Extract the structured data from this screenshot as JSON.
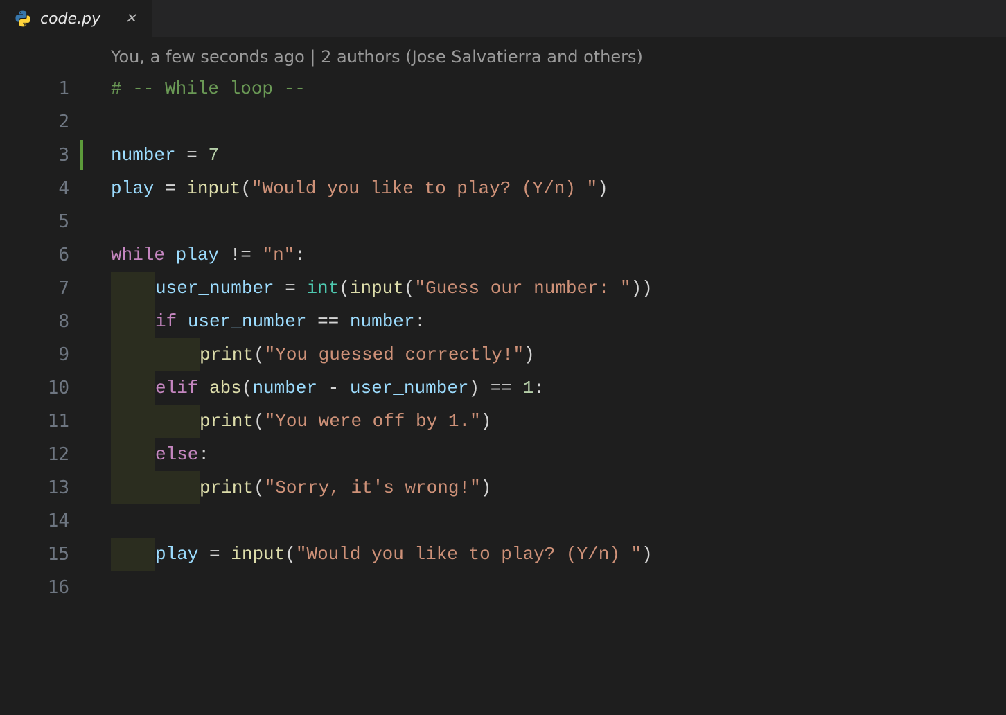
{
  "tab": {
    "filename": "code.py",
    "icon": "python-icon"
  },
  "codelens": "You, a few seconds ago | 2 authors (Jose Salvatierra and others)",
  "line_numbers": [
    "1",
    "2",
    "3",
    "4",
    "5",
    "6",
    "7",
    "8",
    "9",
    "10",
    "11",
    "12",
    "13",
    "14",
    "15",
    "16"
  ],
  "tokens": {
    "l1_comment": "# -- While loop --",
    "l3_var": "number",
    "l3_eq": " = ",
    "l3_num": "7",
    "l4_var": "play",
    "l4_eq": " = ",
    "l4_func": "input",
    "l4_p1": "(",
    "l4_str": "\"Would you like to play? (Y/n) \"",
    "l4_p2": ")",
    "l6_kw": "while",
    "l6_sp": " ",
    "l6_var": "play",
    "l6_op": " != ",
    "l6_str": "\"n\"",
    "l6_colon": ":",
    "l7_var1": "user_number",
    "l7_eq": " = ",
    "l7_int": "int",
    "l7_p1": "(",
    "l7_input": "input",
    "l7_p2": "(",
    "l7_str": "\"Guess our number: \"",
    "l7_p3": "))",
    "l8_kw": "if",
    "l8_sp": " ",
    "l8_var1": "user_number",
    "l8_op": " == ",
    "l8_var2": "number",
    "l8_colon": ":",
    "l9_print": "print",
    "l9_p1": "(",
    "l9_str": "\"You guessed correctly!\"",
    "l9_p2": ")",
    "l10_kw": "elif",
    "l10_sp": " ",
    "l10_abs": "abs",
    "l10_p1": "(",
    "l10_var1": "number",
    "l10_op": " - ",
    "l10_var2": "user_number",
    "l10_p2": ")",
    "l10_op2": " == ",
    "l10_num": "1",
    "l10_colon": ":",
    "l11_print": "print",
    "l11_p1": "(",
    "l11_str": "\"You were off by 1.\"",
    "l11_p2": ")",
    "l12_kw": "else",
    "l12_colon": ":",
    "l13_print": "print",
    "l13_p1": "(",
    "l13_str": "\"Sorry, it's wrong!\"",
    "l13_p2": ")",
    "l15_var": "play",
    "l15_eq": " = ",
    "l15_input": "input",
    "l15_p1": "(",
    "l15_str": "\"Would you like to play? (Y/n) \"",
    "l15_p2": ")"
  }
}
